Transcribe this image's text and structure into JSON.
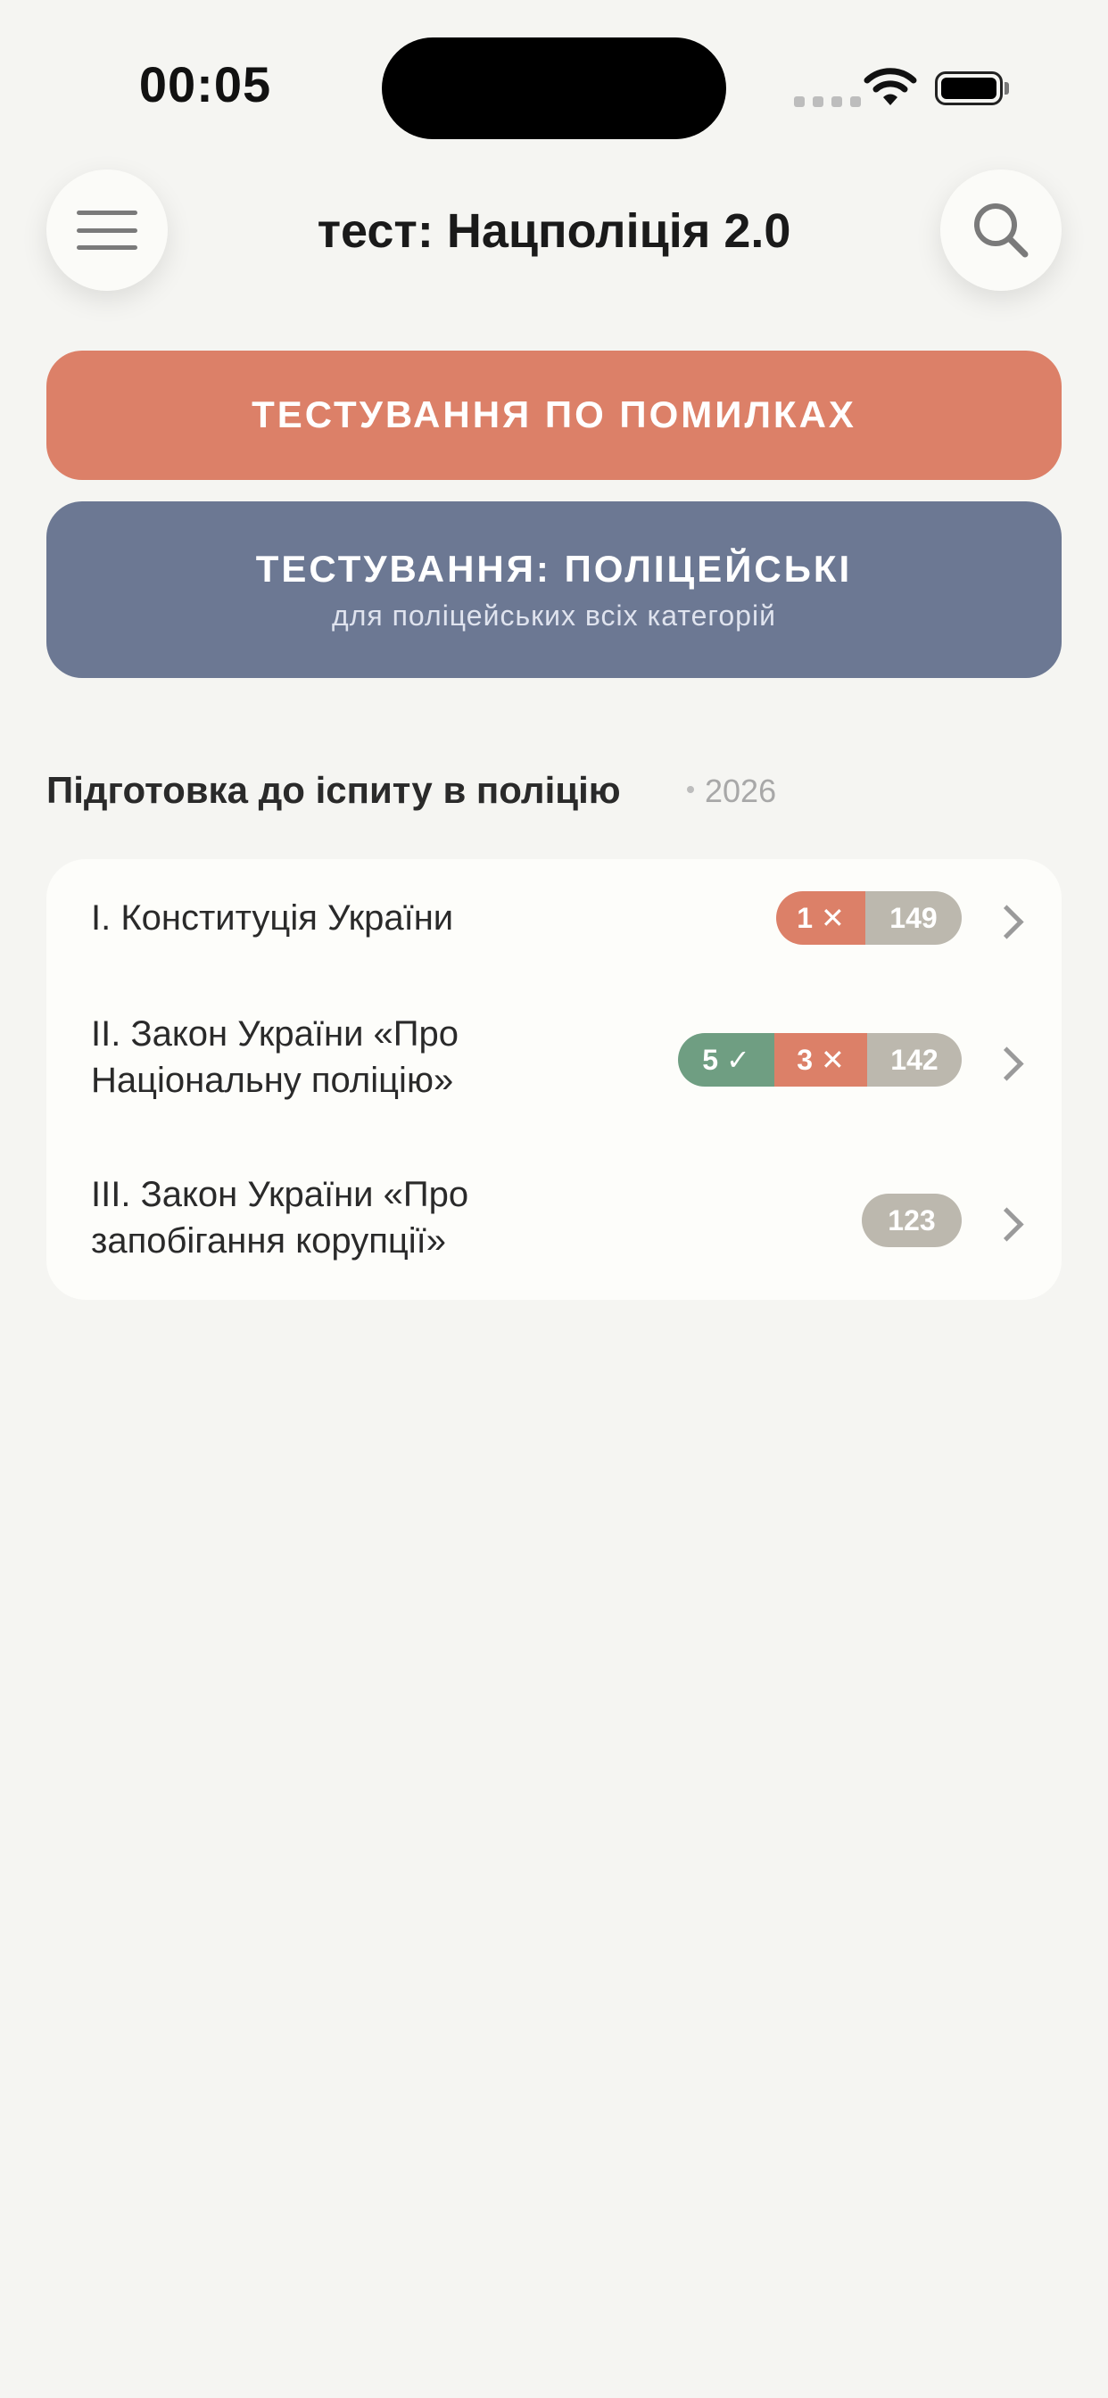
{
  "status_bar": {
    "time": "00:05"
  },
  "nav": {
    "title": "тест: Нацполіція 2.0"
  },
  "buttons": {
    "mistakes": {
      "label": "ТЕСТУВАННЯ ПО ПОМИЛКАХ",
      "color": "#dc8068"
    },
    "police": {
      "label": "ТЕСТУВАННЯ: ПОЛІЦЕЙСЬКІ",
      "subtitle": "для поліцейських всіх категорій",
      "color": "#6c7893"
    }
  },
  "section": {
    "title": "Підготовка до іспиту в поліцію",
    "year": "2026"
  },
  "sections_list": [
    {
      "line1": "I. Конституція України",
      "line2": "",
      "correct": "",
      "wrong": "1 ✕",
      "total": "149"
    },
    {
      "line1": "II. Закон України «Про",
      "line2": "Національну поліцію»",
      "correct": "5 ✓",
      "wrong": "3 ✕",
      "total": "142"
    },
    {
      "line1": "III. Закон України «Про",
      "line2": "запобігання корупції»",
      "correct": "",
      "wrong": "",
      "total": "123"
    }
  ],
  "colors": {
    "correct": "#6f9e82",
    "wrong": "#dc8068",
    "total": "#bcb8ae",
    "background": "#f5f5f2"
  },
  "icons": {
    "menu": "hamburger-icon",
    "search": "search-icon",
    "chevron": "chevron-right-icon",
    "wifi": "wifi-icon",
    "battery": "battery-icon"
  }
}
